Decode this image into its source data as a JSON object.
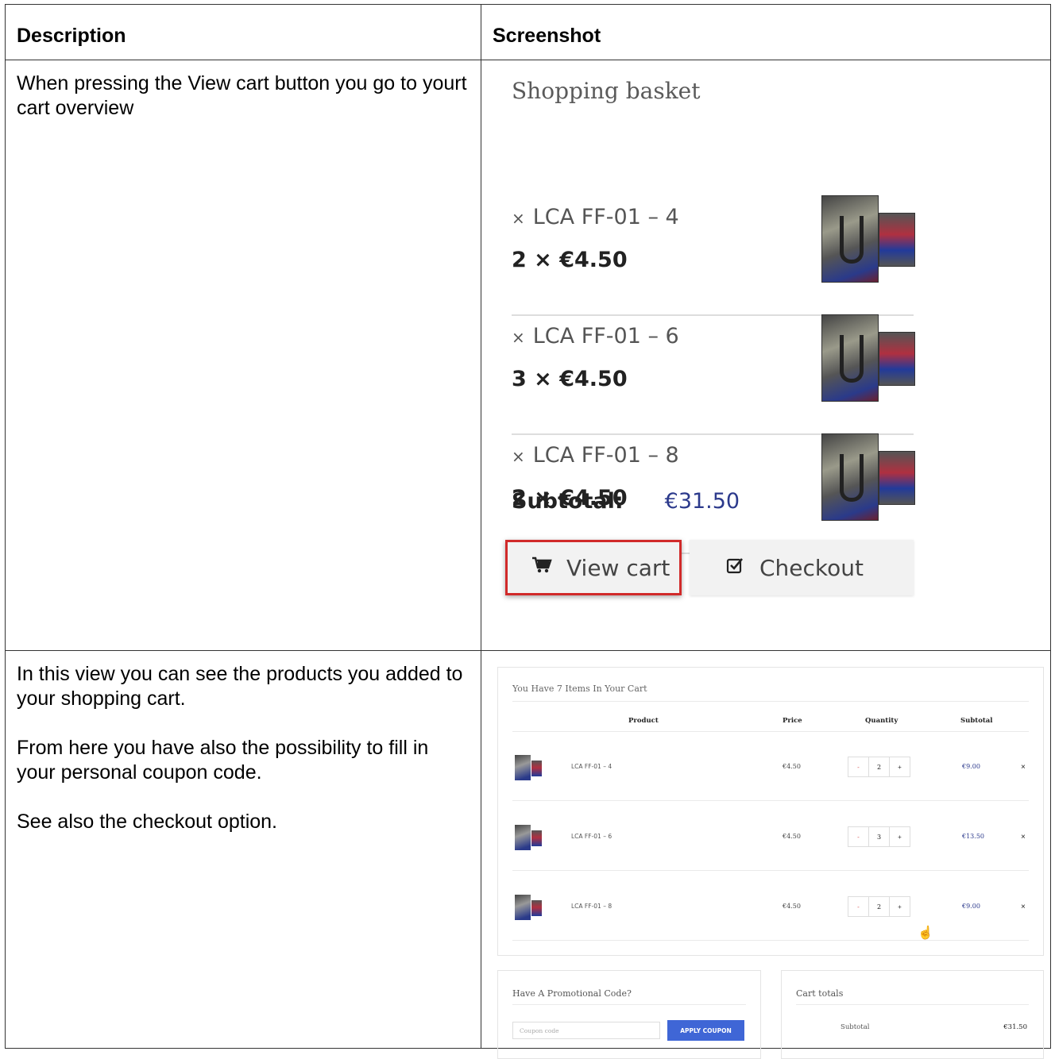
{
  "table": {
    "header_description": "Description",
    "header_screenshot": "Screenshot"
  },
  "row1": {
    "description": "When pressing the View cart button you go to yourt cart overview",
    "mini_cart": {
      "title": "Shopping basket",
      "items": [
        {
          "name": "LCA FF-01 – 4",
          "qty": "2 × €4.50"
        },
        {
          "name": "LCA FF-01 – 6",
          "qty": "3 × €4.50"
        },
        {
          "name": "LCA FF-01 – 8",
          "qty": "2 × €4.50"
        }
      ],
      "remove_symbol": "×",
      "subtotal_label": "Subtotal:",
      "subtotal_value": "€31.50",
      "view_cart_label": "View cart",
      "checkout_label": "Checkout",
      "view_cart_icon": "cart-icon",
      "checkout_icon": "checkbox-icon",
      "highlight_color": "#d12a2a"
    }
  },
  "row2": {
    "paragraphs": [
      "In this view you can see the products you added to your shopping cart.",
      "From here you have also the possibility to fill in your personal coupon code.",
      "See also the checkout option."
    ],
    "cart": {
      "heading": "You Have 7 Items In Your Cart",
      "columns": {
        "product": "Product",
        "price": "Price",
        "quantity": "Quantity",
        "subtotal": "Subtotal"
      },
      "rows": [
        {
          "name": "LCA FF-01 – 4",
          "price": "€4.50",
          "qty": "2",
          "subtotal": "€9.00"
        },
        {
          "name": "LCA FF-01 – 6",
          "price": "€4.50",
          "qty": "3",
          "subtotal": "€13.50"
        },
        {
          "name": "LCA FF-01 – 8",
          "price": "€4.50",
          "qty": "2",
          "subtotal": "€9.00"
        }
      ],
      "minus": "-",
      "plus": "+",
      "remove": "×",
      "promo_title": "Have A Promotional Code?",
      "coupon_placeholder": "Coupon code",
      "apply_coupon": "APPLY COUPON",
      "totals_title": "Cart totals",
      "totals_subtotal_label": "Subtotal",
      "totals_subtotal_value": "€31.50",
      "accent_color": "#3f66d6"
    }
  }
}
